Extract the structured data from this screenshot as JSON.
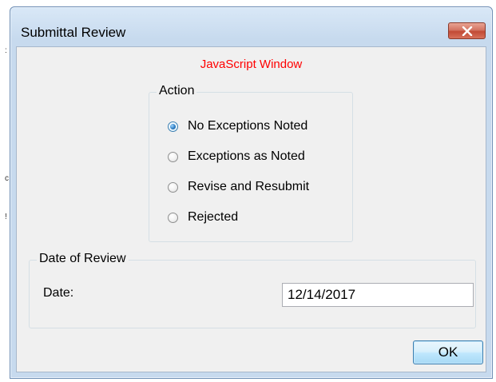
{
  "window": {
    "title": "Submittal Review"
  },
  "header_label": "JavaScript Window",
  "action_group": {
    "legend": "Action",
    "options": [
      {
        "label": "No Exceptions Noted",
        "selected": true
      },
      {
        "label": "Exceptions as Noted",
        "selected": false
      },
      {
        "label": "Revise and Resubmit",
        "selected": false
      },
      {
        "label": "Rejected",
        "selected": false
      }
    ]
  },
  "date_group": {
    "legend": "Date of Review",
    "field_label": "Date:",
    "value": "12/14/2017"
  },
  "buttons": {
    "ok": "OK"
  },
  "colors": {
    "header_label": "#ff0000",
    "accent": "#3c7fb1",
    "close_button": "#c24a35"
  }
}
